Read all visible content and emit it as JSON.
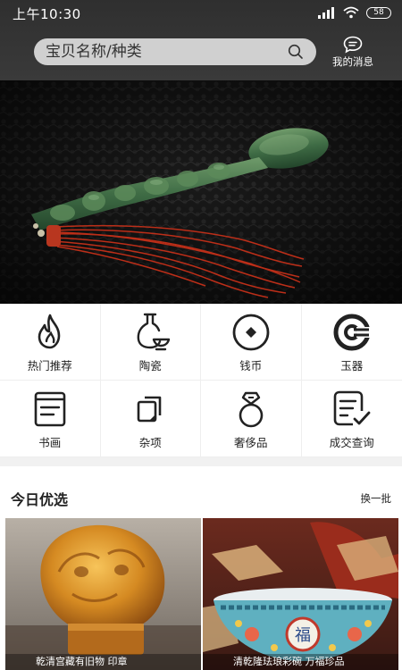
{
  "status_bar": {
    "time": "上午10:30",
    "battery": "58"
  },
  "header": {
    "search_placeholder": "宝贝名称/种类",
    "messages_label": "我的消息"
  },
  "categories": [
    {
      "label": "热门推荐",
      "icon": "flame-icon"
    },
    {
      "label": "陶瓷",
      "icon": "vase-icon"
    },
    {
      "label": "钱币",
      "icon": "coin-icon"
    },
    {
      "label": "玉器",
      "icon": "jade-icon"
    },
    {
      "label": "书画",
      "icon": "document-icon"
    },
    {
      "label": "杂项",
      "icon": "copy-icon"
    },
    {
      "label": "奢侈品",
      "icon": "ring-icon"
    },
    {
      "label": "成交查询",
      "icon": "checklist-icon"
    }
  ],
  "today": {
    "title": "今日优选",
    "refresh_label": "换一批",
    "items": [
      {
        "caption": "乾清宫藏有旧物 印章"
      },
      {
        "caption": "清乾隆珐琅彩碗 万福珍品"
      }
    ]
  }
}
